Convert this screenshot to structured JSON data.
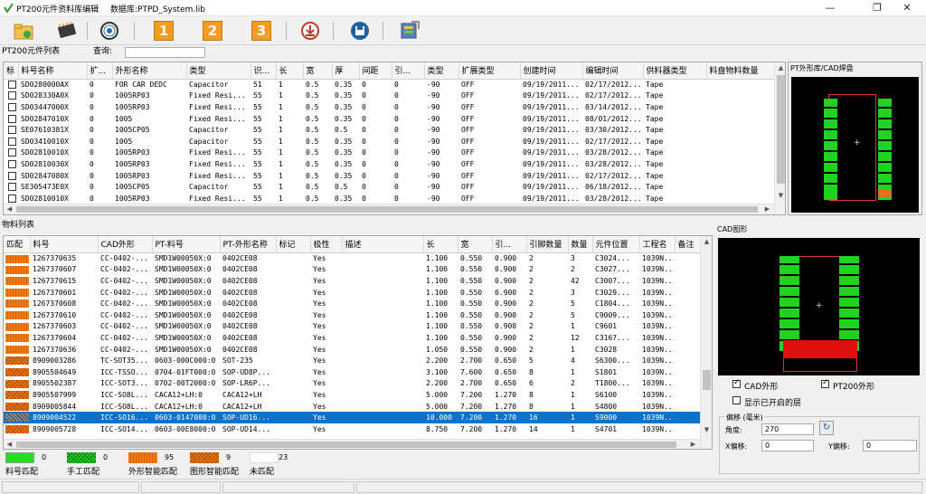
{
  "window": {
    "app_title": "PT200元件资料库编辑",
    "db_label": "数据库:PTPD_System.lib",
    "min": "—",
    "max": "❐",
    "close": "✕"
  },
  "toolbar": {
    "icons": [
      "open-folder-icon",
      "chip-icon",
      "reel-icon",
      "step-1-icon",
      "step-2-icon",
      "step-3-icon",
      "import-icon",
      "save-icon",
      "export-icon"
    ],
    "numbers": [
      "1",
      "2",
      "3"
    ]
  },
  "top": {
    "section": "PT200元件列表",
    "query_label": "查询:",
    "query_value": "",
    "columns": [
      "标",
      "料号名称",
      "扩...",
      "外形名称",
      "类型",
      "识...",
      "长",
      "宽",
      "厚",
      "间距",
      "引...",
      "类型",
      "扩展类型",
      "创建时间",
      "编辑时间",
      "供料器类型",
      "料盘物料数量",
      "..."
    ],
    "rows": [
      [
        "",
        "SD0280000AX",
        "0",
        "FOR CAR DEDC",
        "Capacitor",
        "51",
        "1",
        "0.5",
        "0.35",
        "0",
        "0",
        "-90",
        "OFF",
        "09/19/2011...",
        "02/17/2012...",
        "Tape",
        "",
        "3"
      ],
      [
        "",
        "SD028330A0X",
        "0",
        "1005RP03",
        "Fixed Resi...",
        "55",
        "1",
        "0.5",
        "0.35",
        "0",
        "0",
        "-90",
        "OFF",
        "09/19/2011...",
        "02/17/2012...",
        "Tape",
        "",
        "3"
      ],
      [
        "",
        "SD03447000X",
        "0",
        "1005RP03",
        "Fixed Resi...",
        "55",
        "1",
        "0.5",
        "0.35",
        "0",
        "0",
        "-90",
        "OFF",
        "09/19/2011...",
        "03/14/2012...",
        "Tape",
        "",
        "3"
      ],
      [
        "",
        "SD02847010X",
        "0",
        "1005",
        "Fixed Resi...",
        "55",
        "1",
        "0.5",
        "0.35",
        "0",
        "0",
        "-90",
        "OFF",
        "09/19/2011...",
        "08/01/2012...",
        "Tape",
        "",
        "3"
      ],
      [
        "",
        "SE07610381X",
        "0",
        "1005CP05",
        "Capacitor",
        "55",
        "1",
        "0.5",
        "0.5",
        "0",
        "0",
        "-90",
        "OFF",
        "09/19/2011...",
        "03/30/2012...",
        "Tape",
        "",
        "1"
      ],
      [
        "",
        "SD03410010X",
        "0",
        "1005",
        "Capacitor",
        "55",
        "1",
        "0.5",
        "0.35",
        "0",
        "0",
        "-90",
        "OFF",
        "09/19/2011...",
        "02/17/2012...",
        "Tape",
        "",
        "3"
      ],
      [
        "",
        "SD02810010X",
        "0",
        "1005RP03",
        "Fixed Resi...",
        "55",
        "1",
        "0.5",
        "0.35",
        "0",
        "0",
        "-90",
        "OFF",
        "09/19/2011...",
        "03/28/2012...",
        "Tape",
        "",
        "3"
      ],
      [
        "",
        "SD02810030X",
        "0",
        "1005RP03",
        "Fixed Resi...",
        "55",
        "1",
        "0.5",
        "0.35",
        "0",
        "0",
        "-90",
        "OFF",
        "09/19/2011...",
        "03/28/2012...",
        "Tape",
        "",
        "3"
      ],
      [
        "",
        "SD02847080X",
        "0",
        "1005RP03",
        "Fixed Resi...",
        "55",
        "1",
        "0.5",
        "0.35",
        "0",
        "0",
        "-90",
        "OFF",
        "09/19/2011...",
        "02/17/2012...",
        "Tape",
        "",
        "3"
      ],
      [
        "",
        "SE305473E0X",
        "0",
        "1005CP05",
        "Capacitor",
        "55",
        "1",
        "0.5",
        "0.5",
        "0",
        "0",
        "-90",
        "OFF",
        "09/19/2011...",
        "06/18/2012...",
        "Tape",
        "",
        "3"
      ],
      [
        "",
        "SD02810010X",
        "0",
        "1005RP03",
        "Fixed Resi...",
        "55",
        "1",
        "0.5",
        "0.35",
        "0",
        "0",
        "-90",
        "OFF",
        "09/19/2011...",
        "03/28/2012...",
        "Tape",
        "",
        "3"
      ]
    ]
  },
  "pt_panel": {
    "title": "PT外形库/CAD焊盘"
  },
  "bottom": {
    "section": "物料列表",
    "columns": [
      "匹配",
      "料号",
      "CAD外形",
      "PT-料号",
      "PT-外形名称",
      "标记",
      "极性",
      "描述",
      "长",
      "宽",
      "引...",
      "引脚数量",
      "数量",
      "元件位置",
      "工程名",
      "备注"
    ],
    "rows": [
      {
        "match": "orange",
        "cells": [
          "1267370635",
          "CC-0402-...",
          "SMD1W00050X:0",
          "0402CE08",
          "",
          "Yes",
          "",
          "1.100",
          "0.550",
          "0.900",
          "2",
          "3",
          "C3024...",
          "1039N...",
          ""
        ]
      },
      {
        "match": "orange",
        "cells": [
          "1267370607",
          "CC-0402-...",
          "SMD1W00050X:0",
          "0402CE08",
          "",
          "Yes",
          "",
          "1.100",
          "0.550",
          "0.900",
          "2",
          "2",
          "C3027...",
          "1039N...",
          ""
        ]
      },
      {
        "match": "orange",
        "cells": [
          "1267370615",
          "CC-0402-...",
          "SMD1W00050X:0",
          "0402CE08",
          "",
          "Yes",
          "",
          "1.100",
          "0.550",
          "0.900",
          "2",
          "42",
          "C3007...",
          "1039N...",
          ""
        ]
      },
      {
        "match": "orange",
        "cells": [
          "1267370601",
          "CC-0402-...",
          "SMD1W00050X:0",
          "0402CE08",
          "",
          "Yes",
          "",
          "1.100",
          "0.550",
          "0.900",
          "2",
          "3",
          "C3029...",
          "1039N...",
          ""
        ]
      },
      {
        "match": "orange",
        "cells": [
          "1267370608",
          "CC-0402-...",
          "SMD1W00050X:0",
          "0402CE08",
          "",
          "Yes",
          "",
          "1.100",
          "0.550",
          "0.900",
          "2",
          "5",
          "C1804...",
          "1039N...",
          ""
        ]
      },
      {
        "match": "orange",
        "cells": [
          "1267370610",
          "CC-0402-...",
          "SMD1W00050X:0",
          "0402CE08",
          "",
          "Yes",
          "",
          "1.100",
          "0.550",
          "0.900",
          "2",
          "5",
          "C9009...",
          "1039N...",
          ""
        ]
      },
      {
        "match": "orange",
        "cells": [
          "1267370603",
          "CC-0402-...",
          "SMD1W00050X:0",
          "0402CE08",
          "",
          "Yes",
          "",
          "1.100",
          "0.550",
          "0.900",
          "2",
          "1",
          "C9601",
          "1039N...",
          ""
        ]
      },
      {
        "match": "orange",
        "cells": [
          "1267370604",
          "CC-0402-...",
          "SMD1W00050X:0",
          "0402CE08",
          "",
          "Yes",
          "",
          "1.100",
          "0.550",
          "0.900",
          "2",
          "12",
          "C3167...",
          "1039N...",
          ""
        ]
      },
      {
        "match": "orange",
        "cells": [
          "1267370636",
          "CC-0402-...",
          "SMD1W00050X:0",
          "0402CE08",
          "",
          "Yes",
          "",
          "1.050",
          "0.550",
          "0.900",
          "2",
          "1",
          "C3028",
          "1039N...",
          ""
        ]
      },
      {
        "match": "x",
        "cells": [
          "8909003286",
          "TC-SOT35...",
          "0603-000C000:0",
          "SOT-235",
          "",
          "Yes",
          "",
          "2.200",
          "2.700",
          "0.650",
          "5",
          "4",
          "S6300...",
          "1039N...",
          ""
        ]
      },
      {
        "match": "x",
        "cells": [
          "8905504649",
          "ICC-TSSO...",
          "0704-01FT000:0",
          "SOP-UD8P...",
          "",
          "Yes",
          "",
          "3.100",
          "7.600",
          "0.650",
          "8",
          "1",
          "S1801",
          "1039N...",
          ""
        ]
      },
      {
        "match": "x",
        "cells": [
          "8905502387",
          "ICC-SOT3...",
          "0702-00T2000:0",
          "SOP-LR6P...",
          "",
          "Yes",
          "",
          "2.200",
          "2.700",
          "0.650",
          "6",
          "2",
          "T1800...",
          "1039N...",
          ""
        ]
      },
      {
        "match": "x",
        "cells": [
          "8905507999",
          "ICC-SO8L...",
          "CACA12+LH:0",
          "CACA12+LH",
          "",
          "Yes",
          "",
          "5.000",
          "7.200",
          "1.270",
          "8",
          "1",
          "S6100",
          "1039N...",
          ""
        ]
      },
      {
        "match": "x",
        "cells": [
          "8909005844",
          "ICC-SO8L...",
          "CACA12+LH:0",
          "CACA12+LH",
          "",
          "Yes",
          "",
          "5.000",
          "7.200",
          "1.270",
          "8",
          "1",
          "S4800",
          "1039N...",
          ""
        ]
      },
      {
        "match": "gray",
        "cells": [
          "8909004522",
          "ICC-SO16...",
          "0603-0147000:0",
          "SOP-UD16...",
          "",
          "Yes",
          "",
          "10.000",
          "7.200",
          "1.270",
          "16",
          "1",
          "S9000",
          "1039N...",
          ""
        ],
        "selected": true
      },
      {
        "match": "x",
        "cells": [
          "8909005728",
          "ICC-SO14...",
          "0603-00E8000:0",
          "SOP-UD14...",
          "",
          "Yes",
          "",
          "8.750",
          "7.200",
          "1.270",
          "14",
          "1",
          "S4701",
          "1039N...",
          ""
        ]
      }
    ]
  },
  "legend": [
    {
      "label": "料号匹配",
      "count": "0",
      "style": "green"
    },
    {
      "label": "手工匹配",
      "count": "0",
      "style": "green-x"
    },
    {
      "label": "外形智能匹配",
      "count": "95",
      "style": "orange"
    },
    {
      "label": "图形智能匹配",
      "count": "9",
      "style": "orange-x"
    },
    {
      "label": "未匹配",
      "count": "23",
      "style": "white"
    }
  ],
  "cad_panel": {
    "title": "CAD图形",
    "cb_cad": "CAD外形",
    "cb_pt200": "PT200外形",
    "cb_layers": "显示已开启的层",
    "offset_group": "偏移 (毫米)",
    "angle_label": "角度:",
    "angle_value": "270",
    "x_label": "X偏移:",
    "x_value": "0",
    "y_label": "Y偏移:",
    "y_value": "0"
  }
}
